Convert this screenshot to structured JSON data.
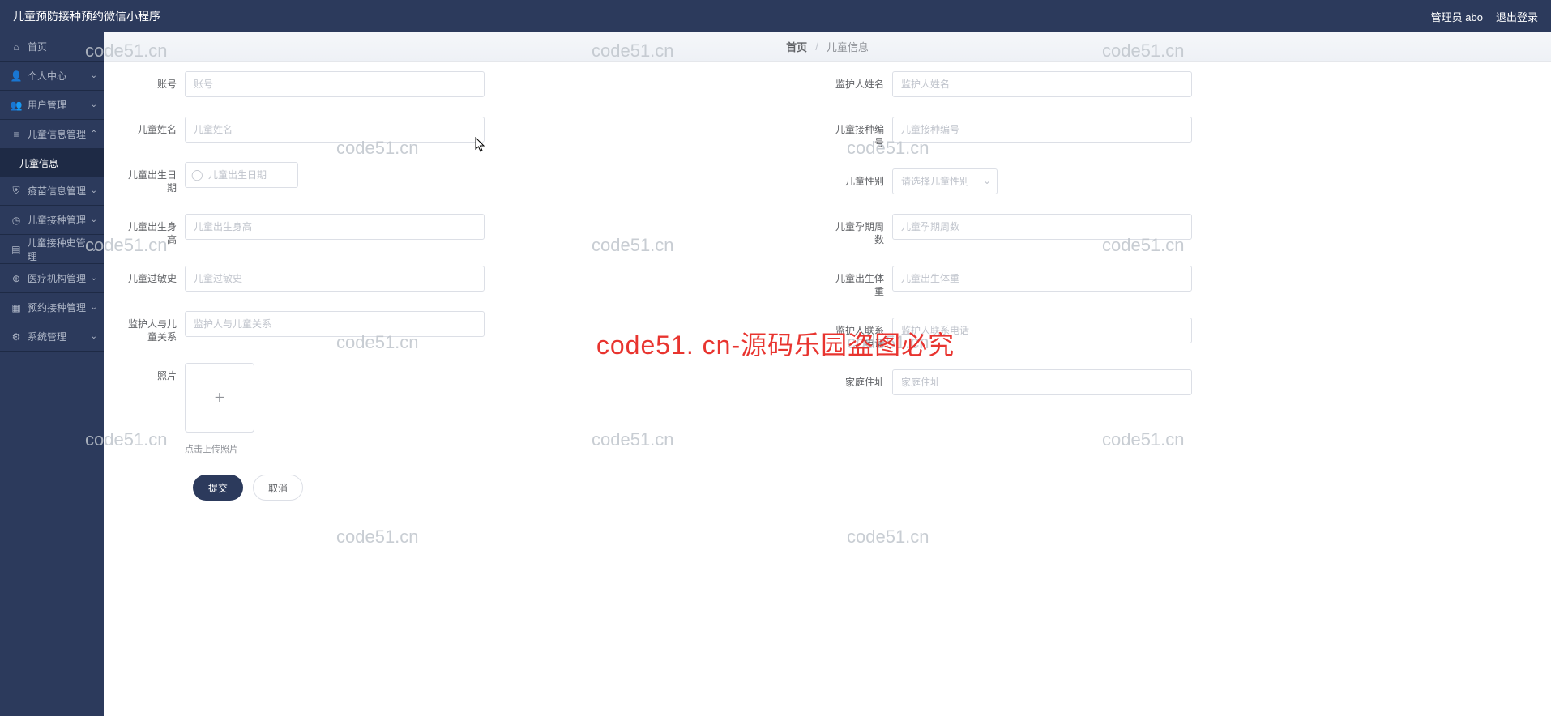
{
  "header": {
    "title": "儿童预防接种预约微信小程序",
    "admin_label": "管理员 abo",
    "logout_label": "退出登录"
  },
  "sidebar": {
    "items": [
      {
        "icon": "home",
        "label": "首页",
        "has_arrow": false
      },
      {
        "icon": "user",
        "label": "个人中心",
        "has_arrow": true
      },
      {
        "icon": "users",
        "label": "用户管理",
        "has_arrow": true
      },
      {
        "icon": "list",
        "label": "儿童信息管理",
        "has_arrow": true,
        "expanded": true,
        "sub": "儿童信息"
      },
      {
        "icon": "shield",
        "label": "疫苗信息管理",
        "has_arrow": true
      },
      {
        "icon": "clock",
        "label": "儿童接种管理",
        "has_arrow": true
      },
      {
        "icon": "doc",
        "label": "儿童接种史管理",
        "has_arrow": true
      },
      {
        "icon": "globe",
        "label": "医疗机构管理",
        "has_arrow": true
      },
      {
        "icon": "calendar",
        "label": "预约接种管理",
        "has_arrow": true
      },
      {
        "icon": "gear",
        "label": "系统管理",
        "has_arrow": true
      }
    ]
  },
  "breadcrumb": {
    "home": "首页",
    "current": "儿童信息"
  },
  "form": {
    "left": {
      "f1": {
        "label": "账号",
        "placeholder": "账号"
      },
      "f2": {
        "label": "儿童姓名",
        "placeholder": "儿童姓名"
      },
      "f3": {
        "label": "儿童出生日期",
        "placeholder": "儿童出生日期"
      },
      "f4": {
        "label": "儿童出生身高",
        "placeholder": "儿童出生身高"
      },
      "f5": {
        "label": "儿童过敏史",
        "placeholder": "儿童过敏史"
      },
      "f6": {
        "label": "监护人与儿童关系",
        "placeholder": "监护人与儿童关系"
      },
      "f7": {
        "label": "照片",
        "hint": "点击上传照片"
      }
    },
    "right": {
      "f1": {
        "label": "监护人姓名",
        "placeholder": "监护人姓名"
      },
      "f2": {
        "label": "儿童接种编号",
        "placeholder": "儿童接种编号"
      },
      "f3": {
        "label": "儿童性别",
        "placeholder": "请选择儿童性别"
      },
      "f4": {
        "label": "儿童孕期周数",
        "placeholder": "儿童孕期周数"
      },
      "f5": {
        "label": "儿童出生体重",
        "placeholder": "儿童出生体重"
      },
      "f6": {
        "label": "监护人联系电话",
        "placeholder": "监护人联系电话"
      },
      "f7": {
        "label": "家庭住址",
        "placeholder": "家庭住址"
      }
    },
    "actions": {
      "submit": "提交",
      "cancel": "取消"
    }
  },
  "watermark": {
    "text": "code51.cn",
    "center": "code51. cn-源码乐园盗图必究"
  }
}
